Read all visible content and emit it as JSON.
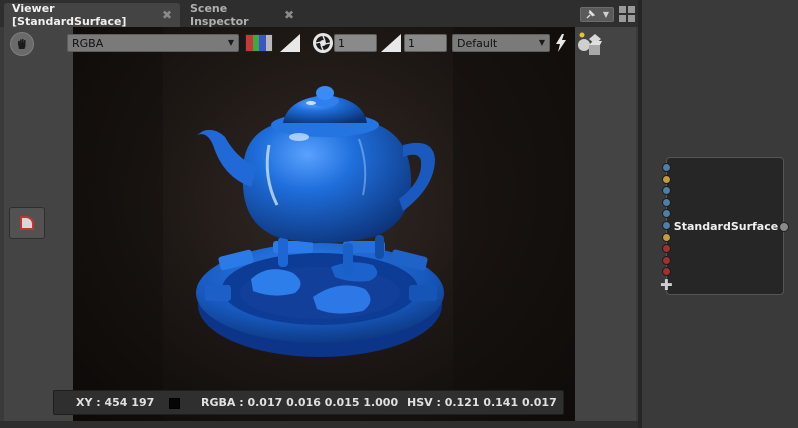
{
  "tabs": [
    {
      "label": "Viewer [StandardSurface]",
      "close": "✖",
      "active": true
    },
    {
      "label": "Scene Inspector",
      "close": "✖",
      "active": false
    }
  ],
  "tab_tools": {
    "pin_icon": "pin-icon",
    "dropdown_glyph": "▼",
    "layout_icon": "grid-layout-icon"
  },
  "toolbar": {
    "channel": {
      "selected": "RGBA",
      "arrow": "▼"
    },
    "channel_strip_colors": [
      "#c23a3a",
      "#3fa83f",
      "#3a55c8",
      "#b8b8b8"
    ],
    "exposure": {
      "value": "1",
      "icon": "aperture-icon"
    },
    "gamma": {
      "value": "1",
      "icon": "gamma-ramp-icon"
    },
    "view_transform": {
      "selected": "Default",
      "arrow": "▼"
    },
    "live_icon": "lightning-icon",
    "scene_icon": "primitives-icon"
  },
  "left_tools": {
    "hand_icon": "hand-icon",
    "side_tool_icon": "material-swatch-icon"
  },
  "status": {
    "xy": "XY : 454 197",
    "rgba": "RGBA : 0.017 0.016 0.015 1.000",
    "hsv": "HSV : 0.121 0.141 0.017",
    "swatch_color": "#050505"
  },
  "node": {
    "title": "StandardSurface",
    "input_port_colors": [
      "#4f7fa6",
      "#c79a3c",
      "#4f7fa6",
      "#4f7fa6",
      "#4f7fa6",
      "#4f7fa6",
      "#c79a3c",
      "#a13030",
      "#a13030",
      "#a13030"
    ],
    "add_port_glyph": "✚"
  },
  "colors": {
    "panel_bg": "#444444",
    "teapot_blue": "#1e6ed8",
    "render_bg": "#1a1512"
  }
}
